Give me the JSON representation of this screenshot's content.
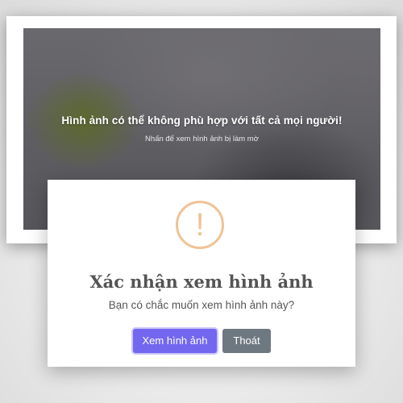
{
  "overlay": {
    "title": "Hình ảnh có thể không phù hợp với tất cả mọi người!",
    "subtitle": "Nhấn để xem hình ảnh bị làm mờ"
  },
  "dialog": {
    "icon": "exclamation-icon",
    "icon_glyph": "!",
    "icon_color": "#f0c294",
    "title": "Xác nhận xem hình ảnh",
    "message": "Bạn có chắc muốn xem hình ảnh này?",
    "confirm_label": "Xem hình ảnh",
    "cancel_label": "Thoát",
    "confirm_color": "#7367f0",
    "cancel_color": "#6e7881"
  }
}
